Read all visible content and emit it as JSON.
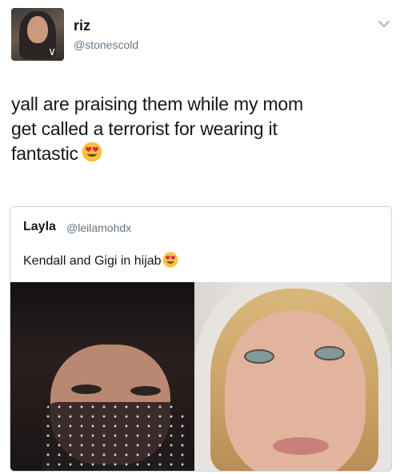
{
  "tweet": {
    "display_name": "riz",
    "handle": "@stonescold",
    "text_lines": [
      "yall are praising them while my mom",
      "get called a terrorist for wearing it",
      "fantastic"
    ],
    "text_emoji": "heart-eyes-emoji"
  },
  "quote": {
    "display_name": "Layla",
    "handle": "@leilamohdx",
    "text": "Kendall and Gigi in hijab",
    "text_emoji": "heart-eyes-emoji"
  },
  "icons": {
    "menu": "chevron-down-icon"
  },
  "colors": {
    "text": "#14171a",
    "secondary_text": "#657786",
    "border": "#ccd6dd",
    "chevron": "#aab8c2",
    "emoji_face": "#f7c23c",
    "emoji_heart": "#e0245e"
  }
}
